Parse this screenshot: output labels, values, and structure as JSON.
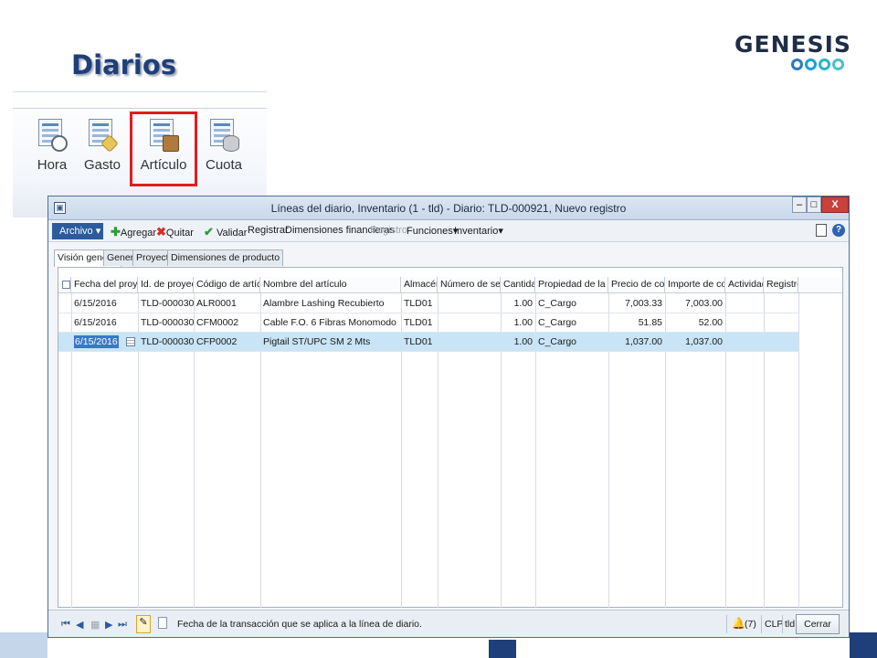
{
  "slide": {
    "title": "Diarios",
    "logo_text": "GENESIS"
  },
  "ribbon": {
    "buttons": [
      {
        "label": "Hora",
        "icon": "clock-journal-icon"
      },
      {
        "label": "Gasto",
        "icon": "tag-journal-icon"
      },
      {
        "label": "Artículo",
        "icon": "box-journal-icon",
        "highlighted": true
      },
      {
        "label": "Cuota",
        "icon": "coins-journal-icon"
      }
    ]
  },
  "window": {
    "title": "Líneas del diario, Inventario (1 - tld) - Diario: TLD-000921, Nuevo registro",
    "controls": {
      "minimize": "–",
      "maximize": "□",
      "close": "X"
    },
    "toolbar": {
      "file": "Archivo",
      "add": "Agregar",
      "remove": "Quitar",
      "validate": "Validar",
      "post": "Registrar",
      "financial_dimensions": "Dimensiones financieras",
      "registration": "Registro",
      "functions": "Funciones",
      "inventory": "Inventario"
    },
    "tabs": [
      "Visión general",
      "General",
      "Proyecto",
      "Dimensiones de producto"
    ],
    "grid": {
      "columns": [
        "Fecha del proyecto",
        "Id. de proyecto",
        "Código de artículo",
        "Nombre del artículo",
        "Almacén",
        "Número de serie",
        "Cantidad",
        "Propiedad de la línea",
        "Precio de coste",
        "Importe de coste",
        "Actividad",
        "Registro"
      ],
      "rows": [
        {
          "date": "6/15/2016",
          "project_id": "TLD-000030",
          "item_code": "ALR0001",
          "item_name": "Alambre Lashing Recubierto",
          "warehouse": "TLD01",
          "serial": "",
          "qty": "1.00",
          "line_property": "C_Cargo",
          "cost_price": "7,003.33",
          "cost_amount": "7,003.00",
          "activity": "",
          "registration": ""
        },
        {
          "date": "6/15/2016",
          "project_id": "TLD-000030",
          "item_code": "CFM0002",
          "item_name": "Cable F.O. 6 Fibras Monomodo",
          "warehouse": "TLD01",
          "serial": "",
          "qty": "1.00",
          "line_property": "C_Cargo",
          "cost_price": "51.85",
          "cost_amount": "52.00",
          "activity": "",
          "registration": ""
        },
        {
          "date": "6/15/2016",
          "project_id": "TLD-000030",
          "item_code": "CFP0002",
          "item_name": "Pigtail ST/UPC SM 2 Mts",
          "warehouse": "TLD01",
          "serial": "",
          "qty": "1.00",
          "line_property": "C_Cargo",
          "cost_price": "1,037.00",
          "cost_amount": "1,037.00",
          "activity": "",
          "registration": "",
          "selected": true
        }
      ]
    },
    "status": {
      "help_text": "Fecha de la transacción que se aplica a la línea de diario.",
      "notifications": "(7)",
      "currency": "CLP",
      "company": "tld",
      "close_button": "Cerrar"
    }
  },
  "colors": {
    "title": "#1f3f7a",
    "highlight": "#e11b22",
    "selected_row": "#c8e4f6",
    "file_button": "#2b5b9d"
  }
}
